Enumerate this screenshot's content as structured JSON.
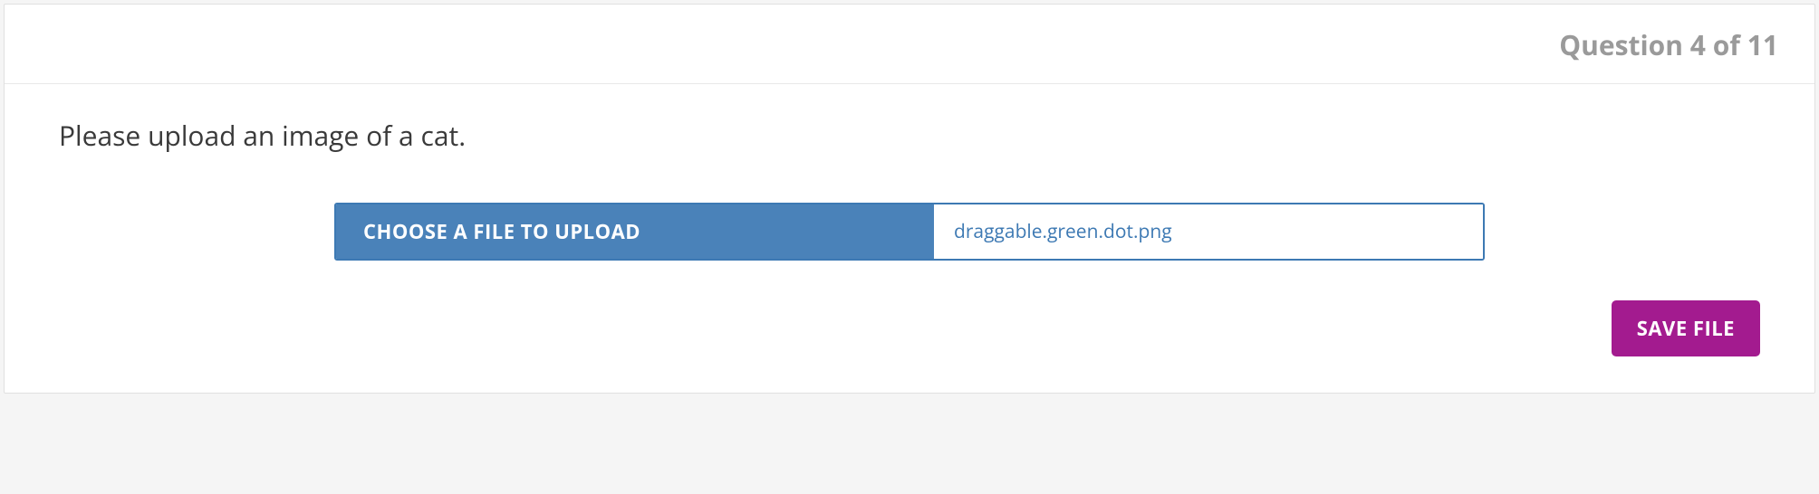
{
  "header": {
    "counter": "Question 4 of 11"
  },
  "prompt": "Please upload an image of a cat.",
  "upload": {
    "choose_label": "CHOOSE A FILE TO UPLOAD",
    "filename": "draggable.green.dot.png"
  },
  "actions": {
    "save_label": "SAVE FILE"
  }
}
